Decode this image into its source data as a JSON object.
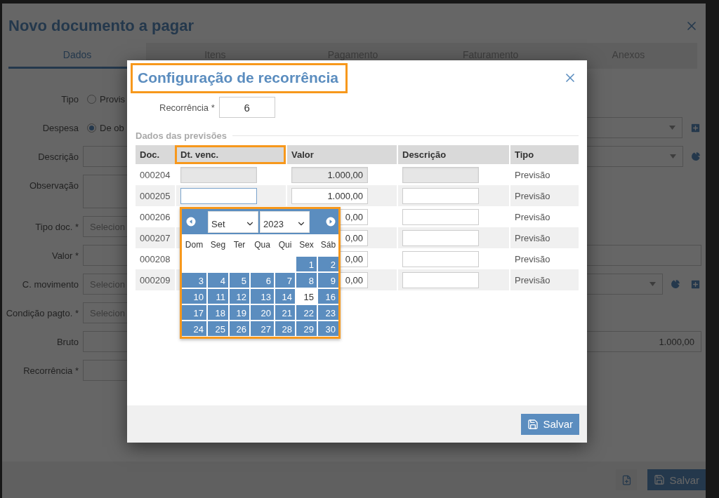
{
  "window": {
    "title": "Novo documento a pagar"
  },
  "tabs": [
    {
      "label": "Dados",
      "selected": true
    },
    {
      "label": "Itens",
      "selected": false
    },
    {
      "label": "Pagamento",
      "selected": false
    },
    {
      "label": "Faturamento",
      "selected": false
    },
    {
      "label": "Anexos",
      "selected": false
    }
  ],
  "form": [
    {
      "label": "Tipo",
      "kind": "radio",
      "option": "Provis",
      "checked": false
    },
    {
      "label": "Despesa",
      "kind": "radio",
      "option": "De ob",
      "checked": true,
      "actions": [
        {
          "kind": "add"
        }
      ]
    },
    {
      "label": "Descrição",
      "kind": "select",
      "actions": [
        {
          "kind": "chart"
        }
      ]
    },
    {
      "label": "Observação",
      "kind": "textarea"
    },
    {
      "label": "Tipo doc. *",
      "kind": "short-select",
      "placeholder": "Selecion"
    },
    {
      "label": "Valor *",
      "kind": "field"
    },
    {
      "label": "C. movimento",
      "kind": "select",
      "placeholder": "Selecion",
      "actions": [
        {
          "kind": "chart"
        },
        {
          "kind": "add"
        }
      ]
    },
    {
      "label": "Condição pagto. *",
      "kind": "short-select",
      "placeholder": "Selecion"
    },
    {
      "label": "Bruto",
      "kind": "field",
      "value": "1.000,00"
    },
    {
      "label": "Recorrência *",
      "kind": "short-field"
    }
  ],
  "footer": {
    "save": "Salvar"
  },
  "modal": {
    "title": "Configuração de recorrência",
    "title_highlighted": true,
    "recurrence": {
      "label": "Recorrência *",
      "value": "6"
    },
    "section": "Dados das previsões",
    "columns": [
      {
        "label": "Doc.",
        "highlighted": false
      },
      {
        "label": "Dt. venc.",
        "highlighted": true
      },
      {
        "label": "Valor",
        "highlighted": false
      },
      {
        "label": "Descrição",
        "highlighted": false
      },
      {
        "label": "Tipo",
        "highlighted": false
      }
    ],
    "rows": [
      {
        "doc": "000204",
        "value": "1.000,00",
        "type": "Previsão",
        "disabled": true,
        "focused": false
      },
      {
        "doc": "000205",
        "value": "1.000,00",
        "type": "Previsão",
        "disabled": false,
        "focused": true
      },
      {
        "doc": "000206",
        "value": "0,00",
        "type": "Previsão",
        "disabled": false
      },
      {
        "doc": "000207",
        "value": "0,00",
        "type": "Previsão",
        "disabled": false
      },
      {
        "doc": "000208",
        "value": "0,00",
        "type": "Previsão",
        "disabled": false
      },
      {
        "doc": "000209",
        "value": "0,00",
        "type": "Previsão",
        "disabled": false
      }
    ],
    "calendar": {
      "highlighted": true,
      "month": "Set",
      "year": "2023",
      "weekdays": [
        "Dom",
        "Seg",
        "Ter",
        "Qua",
        "Qui",
        "Sex",
        "Sáb"
      ],
      "weeks": [
        [
          {
            "kind": "blank"
          },
          {
            "kind": "blank"
          },
          {
            "kind": "blank"
          },
          {
            "kind": "blank"
          },
          {
            "kind": "blank"
          },
          {
            "kind": "day",
            "day": "1",
            "current": false
          },
          {
            "kind": "day",
            "day": "2",
            "current": false
          }
        ],
        [
          {
            "kind": "day",
            "day": "3",
            "current": false
          },
          {
            "kind": "day",
            "day": "4",
            "current": false
          },
          {
            "kind": "day",
            "day": "5",
            "current": false
          },
          {
            "kind": "day",
            "day": "6",
            "current": false
          },
          {
            "kind": "day",
            "day": "7",
            "current": false
          },
          {
            "kind": "day",
            "day": "8",
            "current": false
          },
          {
            "kind": "day",
            "day": "9",
            "current": false
          }
        ],
        [
          {
            "kind": "day",
            "day": "10",
            "current": false
          },
          {
            "kind": "day",
            "day": "11",
            "current": false
          },
          {
            "kind": "day",
            "day": "12",
            "current": false
          },
          {
            "kind": "day",
            "day": "13",
            "current": false
          },
          {
            "kind": "day",
            "day": "14",
            "current": false
          },
          {
            "kind": "day",
            "day": "15",
            "current": true
          },
          {
            "kind": "day",
            "day": "16",
            "current": false
          }
        ],
        [
          {
            "kind": "day",
            "day": "17",
            "current": false
          },
          {
            "kind": "day",
            "day": "18",
            "current": false
          },
          {
            "kind": "day",
            "day": "19",
            "current": false
          },
          {
            "kind": "day",
            "day": "20",
            "current": false
          },
          {
            "kind": "day",
            "day": "21",
            "current": false
          },
          {
            "kind": "day",
            "day": "22",
            "current": false
          },
          {
            "kind": "day",
            "day": "23",
            "current": false
          }
        ],
        [
          {
            "kind": "day",
            "day": "24",
            "current": false
          },
          {
            "kind": "day",
            "day": "25",
            "current": false
          },
          {
            "kind": "day",
            "day": "26",
            "current": false
          },
          {
            "kind": "day",
            "day": "27",
            "current": false
          },
          {
            "kind": "day",
            "day": "28",
            "current": false
          },
          {
            "kind": "day",
            "day": "29",
            "current": false
          },
          {
            "kind": "day",
            "day": "30",
            "current": false
          }
        ]
      ]
    },
    "save": "Salvar"
  }
}
